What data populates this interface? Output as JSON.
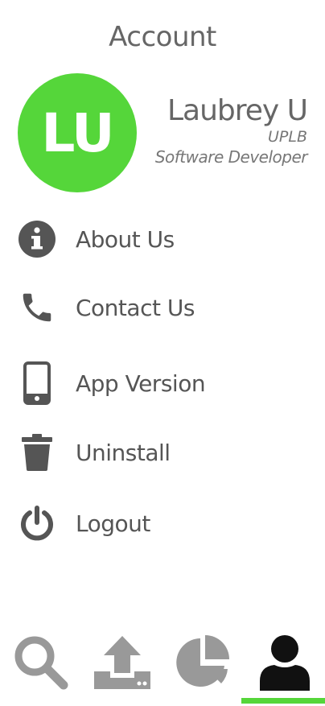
{
  "header": {
    "title": "Account"
  },
  "profile": {
    "initials": "LU",
    "name": "Laubrey U",
    "organization": "UPLB",
    "role": "Software Developer",
    "avatar_color": "#55d63a"
  },
  "menu": {
    "items": [
      {
        "label": "About Us",
        "icon": "info-icon"
      },
      {
        "label": "Contact Us",
        "icon": "phone-icon"
      },
      {
        "label": "App Version",
        "icon": "smartphone-icon"
      },
      {
        "label": "Uninstall",
        "icon": "trash-icon"
      },
      {
        "label": "Logout",
        "icon": "power-icon"
      }
    ]
  },
  "tabbar": {
    "tabs": [
      {
        "icon": "search-icon"
      },
      {
        "icon": "upload-icon"
      },
      {
        "icon": "pie-chart-icon"
      },
      {
        "icon": "user-icon",
        "active": true
      }
    ],
    "active_color": "#55d63a"
  }
}
